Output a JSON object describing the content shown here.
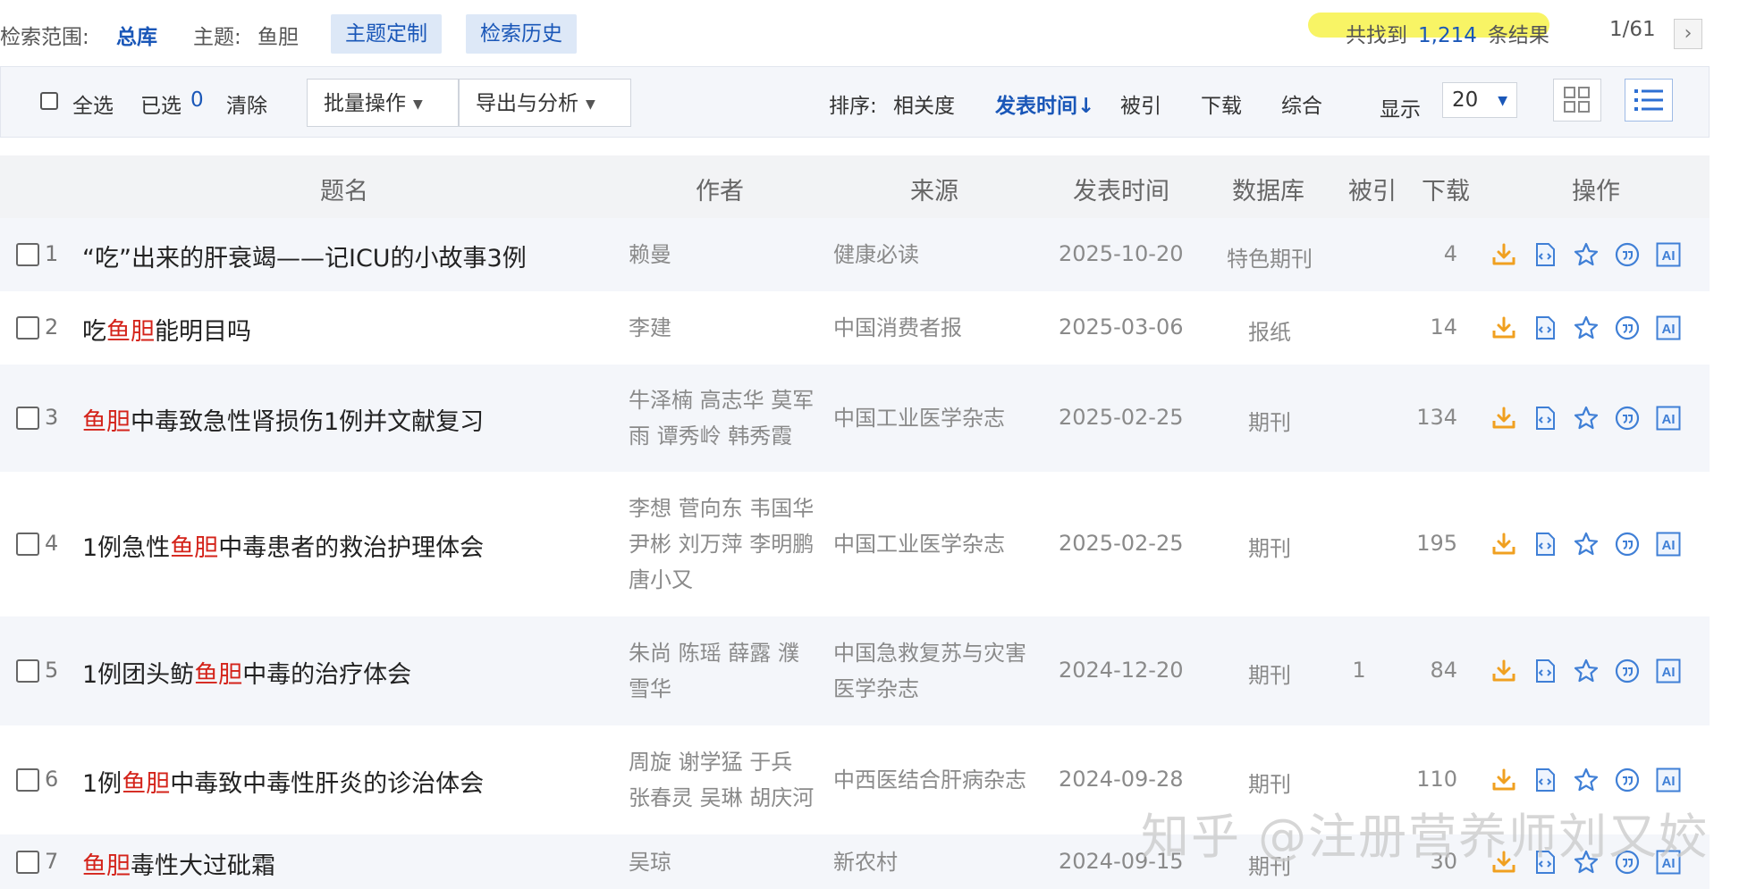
{
  "scope": {
    "range_label": "检索范围:",
    "range_value": "总库",
    "topic_label": "主题:",
    "topic_value": "鱼胆",
    "custom_button": "主题定制",
    "history_button": "检索历史",
    "found_prefix": "共找到",
    "found_count": "1,214",
    "found_suffix": "条结果",
    "page_indicator": "1/61",
    "next_icon": "chevron-right-icon"
  },
  "toolbar": {
    "select_all": "全选",
    "selected_label": "已选",
    "selected_count": "0",
    "clear": "清除",
    "batch_ops": "批量操作",
    "export_analysis": "导出与分析",
    "sort_label": "排序:",
    "sort_relevance": "相关度",
    "sort_date": "发表时间",
    "sort_date_arrow": "↓",
    "sort_cited": "被引",
    "sort_downloads": "下载",
    "sort_overall": "综合",
    "display_label": "显示",
    "page_size": "20"
  },
  "table": {
    "headers": {
      "title": "题名",
      "author": "作者",
      "source": "来源",
      "date": "发表时间",
      "database": "数据库",
      "cited": "被引",
      "downloads": "下载",
      "ops": "操作"
    },
    "rows": [
      {
        "num": "1",
        "title_pre": "“吃”出来的肝衰竭——记ICU的小故事3例",
        "hit": "",
        "title_post": "",
        "authors": [
          "赖曼"
        ],
        "source": [
          "健康必读"
        ],
        "date": "2025-10-20",
        "database": "特色期刊",
        "cited": "",
        "downloads": "4"
      },
      {
        "num": "2",
        "title_pre": "吃",
        "hit": "鱼胆",
        "title_post": "能明目吗",
        "authors": [
          "李建"
        ],
        "source": [
          "中国消费者报"
        ],
        "date": "2025-03-06",
        "database": "报纸",
        "cited": "",
        "downloads": "14"
      },
      {
        "num": "3",
        "title_pre": "",
        "hit": "鱼胆",
        "title_post": "中毒致急性肾损伤1例并文献复习",
        "authors": [
          "牛泽楠 高志华 莫军",
          "雨 谭秀岭 韩秀霞"
        ],
        "source": [
          "中国工业医学杂志"
        ],
        "date": "2025-02-25",
        "database": "期刊",
        "cited": "",
        "downloads": "134"
      },
      {
        "num": "4",
        "title_pre": "1例急性",
        "hit": "鱼胆",
        "title_post": "中毒患者的救治护理体会",
        "authors": [
          "李想 菅向东 韦国华",
          "尹彬 刘万萍 李明鹏",
          "唐小又"
        ],
        "source": [
          "中国工业医学杂志"
        ],
        "date": "2025-02-25",
        "database": "期刊",
        "cited": "",
        "downloads": "195"
      },
      {
        "num": "5",
        "title_pre": "1例团头鲂",
        "hit": "鱼胆",
        "title_post": "中毒的治疗体会",
        "authors": [
          "朱尚 陈瑶 薛露 濮",
          "雪华"
        ],
        "source": [
          "中国急救复苏与灾害",
          "医学杂志"
        ],
        "date": "2024-12-20",
        "database": "期刊",
        "cited": "1",
        "downloads": "84"
      },
      {
        "num": "6",
        "title_pre": "1例",
        "hit": "鱼胆",
        "title_post": "中毒致中毒性肝炎的诊治体会",
        "authors": [
          "周旋 谢学猛 于兵",
          "张春灵 吴琳 胡庆河"
        ],
        "source": [
          "中西医结合肝病杂志"
        ],
        "date": "2024-09-28",
        "database": "期刊",
        "cited": "",
        "downloads": "110"
      },
      {
        "num": "7",
        "title_pre": "",
        "hit": "鱼胆",
        "title_post": "毒性大过砒霜",
        "authors": [
          "吴琼"
        ],
        "source": [
          "新农村"
        ],
        "date": "2024-09-15",
        "database": "期刊",
        "cited": "",
        "downloads": "30"
      }
    ],
    "op_icons": [
      "download-icon",
      "html-reader-icon",
      "favorite-star-icon",
      "quote-icon",
      "ai-assistant-icon"
    ],
    "ai_label": "AI"
  },
  "watermark": "知乎 @注册营养师刘又姣",
  "colors": {
    "accent": "#1a57b8",
    "hit": "#d4231a",
    "icon_orange": "#f0a020",
    "icon_blue": "#3f7fd6"
  }
}
